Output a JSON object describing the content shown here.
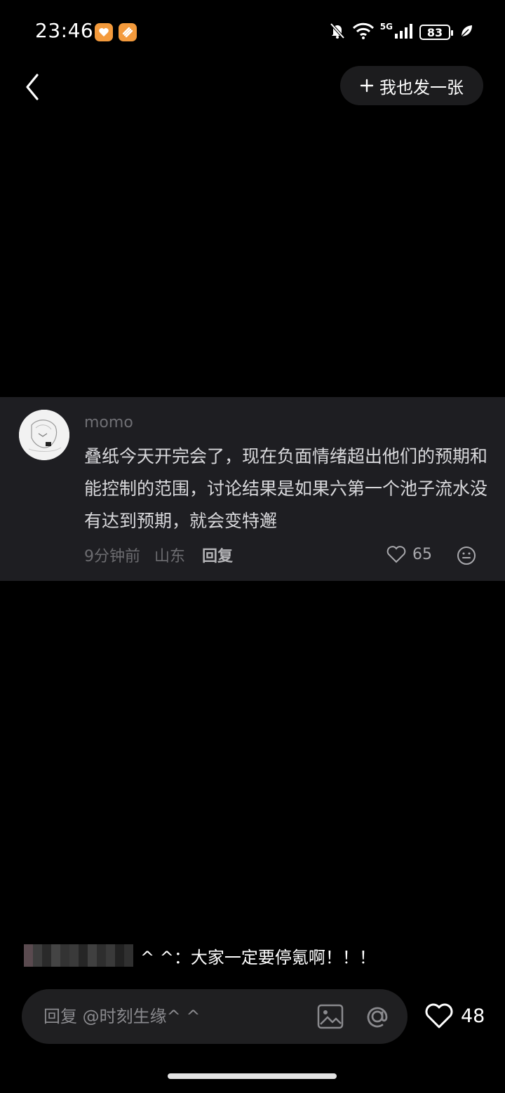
{
  "status_bar": {
    "time": "23:46",
    "network_label": "5G",
    "battery": "83"
  },
  "nav": {
    "post_too_label": "我也发一张"
  },
  "comment": {
    "username": "momo",
    "text": "叠纸今天开完会了，现在负面情绪超出他们的预期和能控制的范围，讨论结果是如果六第一个池子流水没有达到预期，就会变特邂",
    "time_ago": "9分钟前",
    "location": "山东",
    "reply_label": "回复",
    "like_count": "65"
  },
  "danmaku": {
    "text": "^ ^：大家一定要停氪啊！！！"
  },
  "bottom_bar": {
    "reply_placeholder": "回复 @时刻生缘^ ^",
    "like_count": "48"
  },
  "colors": {
    "background": "#000000",
    "card": "#1e1e22",
    "pill": "#1c1c1e",
    "app_icon": "#f39a3c"
  }
}
